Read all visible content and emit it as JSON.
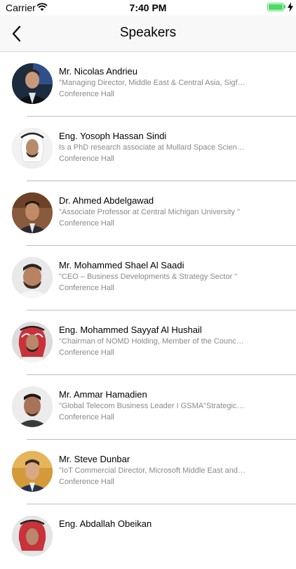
{
  "status_bar": {
    "carrier": "Carrier",
    "time": "7:40 PM"
  },
  "navbar": {
    "title": "Speakers"
  },
  "speakers": [
    {
      "name": "Mr. Nicolas Andrieu",
      "description": "\"Managing Director, Middle East & Central Asia, Sigfox \"",
      "location": "Conference Hall"
    },
    {
      "name": "Eng. Yosoph Hassan Sindi",
      "description": "Is a PhD research associate at Mullard Space Science L...",
      "location": "Conference Hall"
    },
    {
      "name": "Dr. Ahmed Abdelgawad",
      "description": "\"Associate Professor at Central Michigan University \"",
      "location": "Conference Hall"
    },
    {
      "name": "Mr. Mohammed Shael Al Saadi",
      "description": "\"CEO – Business Developments & Strategy Sector \"",
      "location": "Conference Hall"
    },
    {
      "name": "Eng. Mohammed Sayyaf Al Hushail",
      "description": "\"Chairman of NOMD Holding, Member of the Council Of...",
      "location": "Conference Hall"
    },
    {
      "name": "Mr. Ammar Hamadien",
      "description": "\"Global Telecom Business Leader I GSMA\"Strategic Lea...",
      "location": "Conference Hall"
    },
    {
      "name": "Mr. Steve Dunbar",
      "description": "\"IoT Commercial Director, Microsoft Middle East and Afri...",
      "location": "Conference Hall"
    },
    {
      "name": "Eng. Abdallah Obeikan",
      "description": "",
      "location": ""
    }
  ],
  "colors": {
    "battery": "#4cd964",
    "separator": "#bdbdbd",
    "secondary_text": "#8a8a8a"
  }
}
